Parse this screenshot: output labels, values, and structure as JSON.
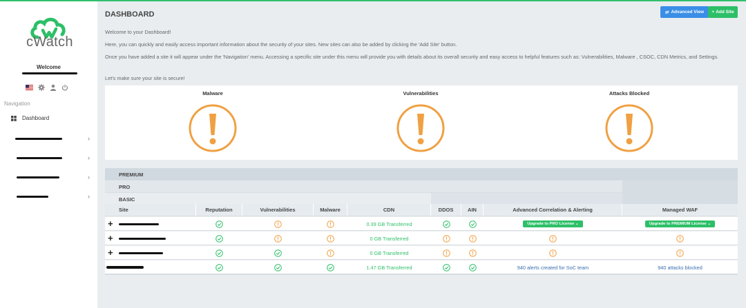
{
  "app": {
    "brand": "cWatch",
    "welcome": "Welcome",
    "nav_label": "Navigation",
    "dashboard_label": "Dashboard",
    "accent": "#2dbf68",
    "blue": "#3a8ee6",
    "warning": "#f0a042"
  },
  "page": {
    "title": "DASHBOARD",
    "advanced_view": "Advanced View",
    "add_site": "Add Site",
    "p1": "Welcome to your Dashboard!",
    "p2": "Here, you can quickly and easily access important information about the security of your sites. New sites can also be added by clicking the 'Add Site' button.",
    "p3": "Once you have added a site it will appear under the 'Navigation' menu. Accessing a specific site under this menu will provide you with details about its overall security and easy access to helpful features such as: Vulnerabilities, Malware , CSOC, CDN Metrics, and Settings.",
    "p4": "Let's make sure your site is secure!"
  },
  "summary": {
    "malware": "Malware",
    "vulnerabilities": "Vulnerabilities",
    "attacks": "Attacks Blocked"
  },
  "table": {
    "tiers": {
      "premium": "PREMIUM",
      "pro": "PRO",
      "basic": "BASIC"
    },
    "headers": {
      "site": "Site",
      "reputation": "Reputation",
      "vulnerabilities": "Vulnerabilities",
      "malware": "Malware",
      "cdn": "CDN",
      "ddos": "DDOS",
      "ain": "AIN",
      "aca": "Advanced Correlation & Alerting",
      "waf": "Managed WAF"
    },
    "rows": [
      {
        "cdn": "0.39 GB Transferred",
        "aca": "Upgrade to PRO License",
        "waf": "Upgrade to PREMIUM License"
      },
      {
        "cdn": "0 GB Transferred"
      },
      {
        "cdn": "0 GB Transferred"
      },
      {
        "cdn": "1.47 GB Transferred",
        "aca": "940 alerts created for SoC team",
        "waf": "940 attacks blocked"
      }
    ]
  }
}
